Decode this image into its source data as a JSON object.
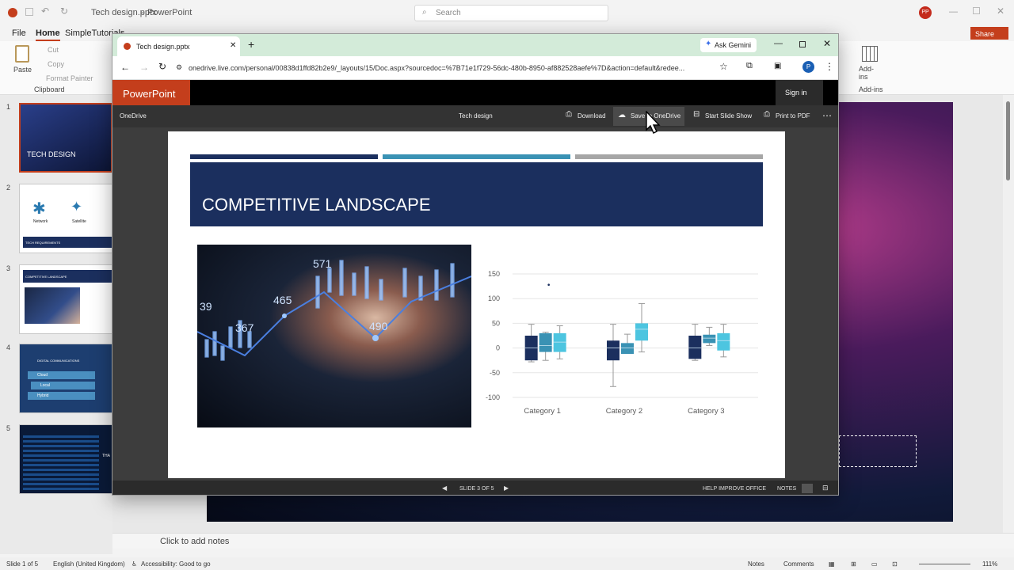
{
  "app": {
    "file_title": "Tech design.pptx",
    "app_name": "PowerPoint",
    "search_placeholder": "Search",
    "user_initials": "PP",
    "share_label": "Share"
  },
  "menu": [
    "File",
    "Home",
    "SimpleTutorials"
  ],
  "ribbon": {
    "paste": "Paste",
    "cut": "Cut",
    "copy": "Copy",
    "format_painter": "Format Painter",
    "clipboard": "Clipboard",
    "addins": "Add-ins",
    "addins_group": "Add-ins"
  },
  "thumbnails": [
    {
      "num": "1",
      "label": "TECH DESIGN"
    },
    {
      "num": "2",
      "label": "TECH REQUIREMENTS",
      "icons": [
        "Network",
        "Satellite"
      ]
    },
    {
      "num": "3",
      "label": "COMPETITIVE LANDSCAPE"
    },
    {
      "num": "4",
      "label": "DIGITAL COMMUNICATIONS",
      "items": [
        "Cloud",
        "Local",
        "Hybrid"
      ]
    },
    {
      "num": "5",
      "label": "THA"
    }
  ],
  "notes_placeholder": "Click to add notes",
  "status": {
    "slide": "Slide 1 of 5",
    "language": "English (United Kingdom)",
    "accessibility": "Accessibility: Good to go",
    "notes": "Notes",
    "comments": "Comments",
    "zoom": "111%"
  },
  "browser": {
    "tab_title": "Tech design.pptx",
    "ask_gemini": "Ask Gemini",
    "url": "onedrive.live.com/personal/00838d1ffd82b2e9/_layouts/15/Doc.aspx?sourcedoc=%7B71e1f729-56dc-480b-8950-af882528aefe%7D&action=default&redee...",
    "profile_initial": "P"
  },
  "viewer": {
    "brand": "PowerPoint",
    "sign_in": "Sign in",
    "onedrive": "OneDrive",
    "doc_title": "Tech design",
    "download": "Download",
    "save_onedrive": "Save to OneDrive",
    "start_slideshow": "Start Slide Show",
    "print_pdf": "Print to PDF",
    "slide_counter": "SLIDE 3 OF 5",
    "help_improve": "HELP IMPROVE OFFICE",
    "notes": "NOTES"
  },
  "slide": {
    "title": "COMPETITIVE LANDSCAPE",
    "image_numbers": [
      "571",
      "465",
      "367",
      "490",
      "39"
    ],
    "colors": {
      "navy": "#1b2f5e",
      "teal": "#3a92b4",
      "cyan": "#4dc5e0",
      "gray": "#a6a6a6"
    }
  },
  "chart_data": {
    "type": "boxplot",
    "categories": [
      "Category 1",
      "Category 2",
      "Category 3"
    ],
    "ylim": [
      -100,
      150
    ],
    "yticks": [
      150,
      100,
      50,
      0,
      -50,
      -100
    ],
    "series": [
      {
        "color": "#1b2f5e",
        "boxes": [
          {
            "min": -28,
            "q1": -25,
            "median": 0,
            "q3": 25,
            "max": 48
          },
          {
            "min": -78,
            "q1": -25,
            "median": 0,
            "q3": 15,
            "max": 48
          },
          {
            "min": -25,
            "q1": -22,
            "median": 0,
            "q3": 25,
            "max": 48
          }
        ]
      },
      {
        "color": "#3a92b4",
        "boxes": [
          {
            "min": -25,
            "q1": -8,
            "median": 5,
            "q3": 30,
            "max": 32
          },
          {
            "min": -10,
            "q1": -12,
            "median": 0,
            "q3": 10,
            "max": 28
          },
          {
            "min": 5,
            "q1": 10,
            "median": 20,
            "q3": 27,
            "max": 42
          }
        ]
      },
      {
        "color": "#4dc5e0",
        "boxes": [
          {
            "min": -22,
            "q1": -8,
            "median": 12,
            "q3": 30,
            "max": 45
          },
          {
            "min": -8,
            "q1": 15,
            "median": 38,
            "q3": 50,
            "max": 90
          },
          {
            "min": -18,
            "q1": -5,
            "median": 15,
            "q3": 30,
            "max": 48
          }
        ]
      }
    ],
    "outliers": [
      {
        "category": 0,
        "series": 0,
        "value": 128
      }
    ]
  }
}
